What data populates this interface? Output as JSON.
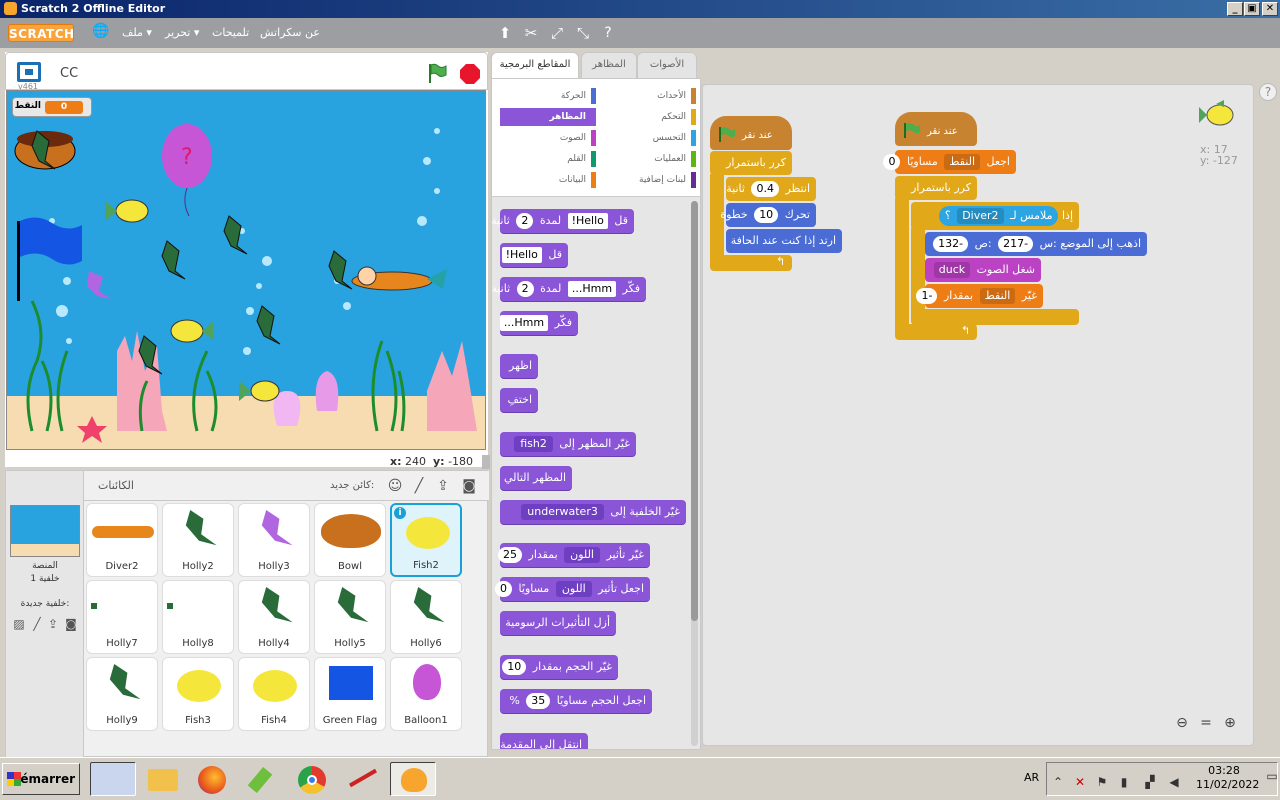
{
  "window": {
    "title": "Scratch 2 Offline Editor",
    "min": "_",
    "max": "▣",
    "close": "✕"
  },
  "menu": {
    "logo": "SCRATCH",
    "file": "ملف ▾",
    "edit": "تحرير ▾",
    "tips": "تلميحات",
    "about": "عن سكراتش",
    "globe": "🌐"
  },
  "stage": {
    "version": "v461",
    "project_name": "CC",
    "var_label": "النقط",
    "var_value": "0",
    "coord_x_label": "x:",
    "coord_x": "240",
    "coord_y_label": "y:",
    "coord_y": "-180"
  },
  "sprites_panel": {
    "title": "الكائنات",
    "new_sprite": "كائن جديد:",
    "stage_label": "المنصة",
    "stage_backdrops": "خلفية 1",
    "new_backdrop": "خلفية جديدة:",
    "sprites": [
      {
        "name": "Diver2"
      },
      {
        "name": "Holly2"
      },
      {
        "name": "Holly3"
      },
      {
        "name": "Bowl"
      },
      {
        "name": "Fish2"
      },
      {
        "name": "Holly7"
      },
      {
        "name": "Holly8"
      },
      {
        "name": "Holly4"
      },
      {
        "name": "Holly5"
      },
      {
        "name": "Holly6"
      },
      {
        "name": "Holly9"
      },
      {
        "name": "Fish3"
      },
      {
        "name": "Fish4"
      },
      {
        "name": "Green Flag"
      },
      {
        "name": "Balloon1"
      }
    ]
  },
  "tabs": {
    "scripts": "المقاطع البرمجية",
    "costumes": "المظاهر",
    "sounds": "الأصوات"
  },
  "categories": [
    {
      "label": "الحركة",
      "color": "#4a6cd4"
    },
    {
      "label": "الأحداث",
      "color": "#c88330"
    },
    {
      "label": "المظاهر",
      "color": "#8a55d7"
    },
    {
      "label": "التحكم",
      "color": "#e1a91a"
    },
    {
      "label": "الصوت",
      "color": "#bb42c3"
    },
    {
      "label": "التحسس",
      "color": "#2ca5e2"
    },
    {
      "label": "القلم",
      "color": "#0e9a6c"
    },
    {
      "label": "العمليات",
      "color": "#5cb712"
    },
    {
      "label": "البيانات",
      "color": "#ee7d16"
    },
    {
      "label": "لبنات إضافية",
      "color": "#632d99"
    }
  ],
  "palette": {
    "say_for_pre": "قل",
    "say_for_val": "Hello!",
    "say_for_mid": "لمدة",
    "say_for_num": "2",
    "say_for_post": "ثانية",
    "say_pre": "قل",
    "say_val": "Hello!",
    "think_for_pre": "فكّر",
    "think_for_val": "Hmm...",
    "think_for_mid": "لمدة",
    "think_for_num": "2",
    "think_for_post": "ثانية",
    "think_pre": "فكّر",
    "think_val": "Hmm...",
    "show": "اظهر",
    "hide": "اختفِ",
    "switch_costume": "غيّر المظهر إلى",
    "costume_val": "fish2",
    "next_costume": "المظهر التالي",
    "switch_backdrop": "غيّر الخلفية إلى",
    "backdrop_val": "underwater3",
    "change_effect": "غيّر تأثير",
    "effect_val": "اللون",
    "change_by": "بمقدار",
    "effect_num": "25",
    "set_effect": "اجعل تأثير",
    "set_effect_to": "مساويًا",
    "set_effect_num": "0",
    "clear_effects": "أزل التأثيرات الرسومية",
    "change_size": "غيّر الحجم بمقدار",
    "size_num": "10",
    "set_size": "اجعل الحجم مساويًا",
    "set_size_num": "35",
    "percent": "%",
    "go_front": "انتقل إلى المقدمة"
  },
  "scripts": {
    "sprite_x": "x: 17",
    "sprite_y": "y: -127",
    "s1": {
      "hat": "عند نقر",
      "forever": "كرر باستمرار",
      "wait": "انتظر",
      "wait_num": "0.4",
      "wait_unit": "ثانية",
      "move": "تحرك",
      "move_num": "10",
      "move_unit": "خطوة",
      "bounce": "ارتد إذا كنت عند الحافة"
    },
    "s2": {
      "hat": "عند نقر",
      "set_var": "اجعل",
      "var_name": "النقط",
      "equals": "مساويًا",
      "set_val": "0",
      "forever": "كرر باستمرار",
      "if_label": "إذا",
      "touching": "ملامس لـ",
      "touch_target": "Diver2",
      "q": "؟",
      "goto": "اذهب إلى الموضع :س",
      "goto_x": "-217",
      "goto_y_label": ":ص",
      "goto_y": "-132",
      "play_sound": "شغل الصوت",
      "sound_val": "duck",
      "change_var": "غيّر",
      "change_var_name": "النقط",
      "change_by": "بمقدار",
      "change_val": "-1"
    }
  },
  "taskbar": {
    "start": "Démarrer",
    "lang": "AR",
    "time": "03:28",
    "date": "11/02/2022"
  }
}
